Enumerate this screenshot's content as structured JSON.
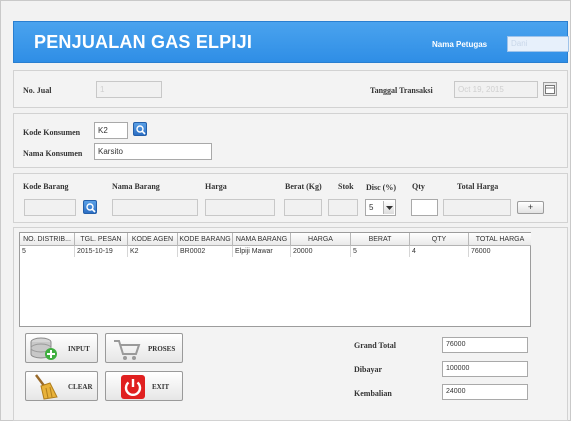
{
  "header": {
    "title": "PENJUALAN GAS ELPIJI",
    "officer_label": "Nama Petugas",
    "officer_value": "Dani"
  },
  "sale": {
    "no_label": "No. Jual",
    "no_value": "1",
    "date_label": "Tanggal Transaksi",
    "date_value": "Oct 19, 2015"
  },
  "consumer": {
    "code_label": "Kode Konsumen",
    "code_value": "K2",
    "name_label": "Nama Konsumen",
    "name_value": "Karsito"
  },
  "item": {
    "code_label": "Kode Barang",
    "name_label": "Nama Barang",
    "price_label": "Harga",
    "weight_label": "Berat (Kg)",
    "stock_label": "Stok",
    "disc_label": "Disc (%)",
    "disc_value": "5",
    "qty_label": "Qty",
    "total_label": "Total Harga",
    "add_label": "+"
  },
  "table": {
    "columns": [
      "NO. DISTRIB...",
      "TGL. PESAN",
      "KODE AGEN",
      "KODE BARANG",
      "NAMA BARANG",
      "HARGA",
      "BERAT",
      "QTY",
      "TOTAL HARGA"
    ],
    "rows": [
      [
        "5",
        "2015-10-19",
        "K2",
        "BR0002",
        "Elpiji Mawar",
        "20000",
        "5",
        "4",
        "76000"
      ]
    ]
  },
  "buttons": {
    "input": "INPUT",
    "proses": "PROSES",
    "clear": "CLEAR",
    "exit": "EXIT"
  },
  "summary": {
    "grand_total_label": "Grand Total",
    "grand_total_value": "76000",
    "paid_label": "Dibayar",
    "paid_value": "100000",
    "change_label": "Kembalian",
    "change_value": "24000"
  },
  "colors": {
    "header_bg": "#2f8ee6",
    "exit_red": "#e02020",
    "search_blue": "#2c6fc4"
  }
}
